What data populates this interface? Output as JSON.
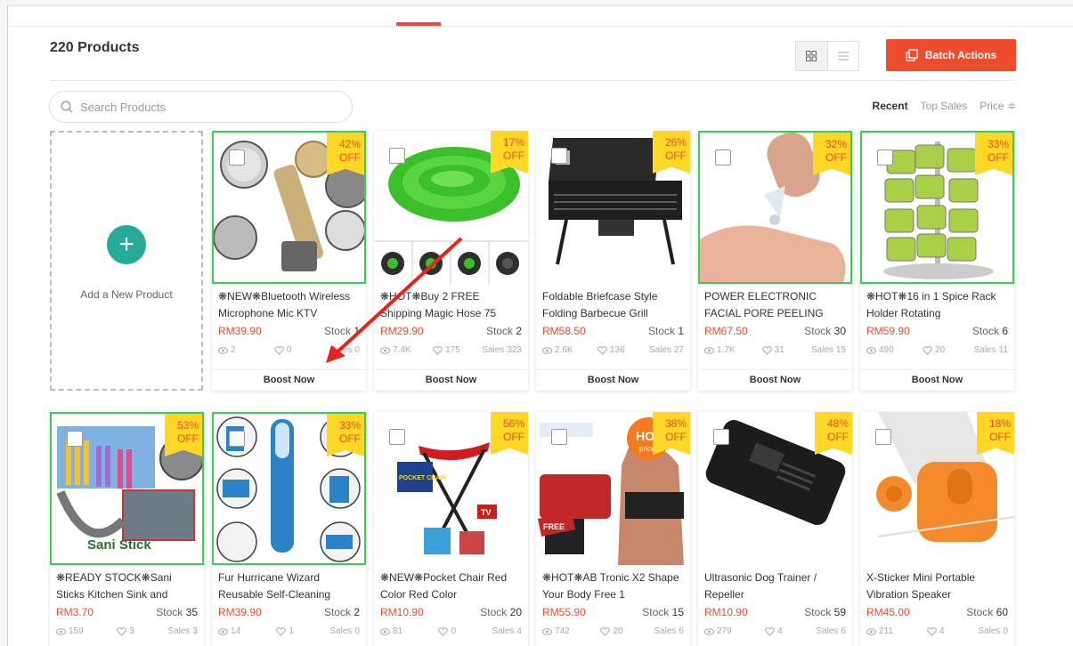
{
  "header": {
    "title": "220 Products",
    "batch_label": "Batch Actions"
  },
  "search": {
    "placeholder": "Search Products"
  },
  "sort": {
    "recent": "Recent",
    "top_sales": "Top Sales",
    "price": "Price ≑"
  },
  "add_card": {
    "label": "Add a New Product"
  },
  "boost_label": "Boost Now",
  "products": [
    {
      "discount": "42%",
      "off": "OFF",
      "name": "❋NEW❋Bluetooth Wireless Microphone Mic KTV",
      "price": "RM39.90",
      "stock_label": "Stock",
      "stock": "1",
      "views": "2",
      "likes": "0",
      "sales_label": "Sales",
      "sales": "0"
    },
    {
      "discount": "17%",
      "off": "OFF",
      "name": "❋HOT❋Buy 2 FREE Shipping Magic Hose 75",
      "price": "RM29.90",
      "stock_label": "Stock",
      "stock": "2",
      "views": "7.4K",
      "likes": "175",
      "sales_label": "Sales",
      "sales": "323"
    },
    {
      "discount": "26%",
      "off": "OFF",
      "name": "Foldable Briefcase Style Folding Barbecue Grill",
      "price": "RM58.50",
      "stock_label": "Stock",
      "stock": "1",
      "views": "2.6K",
      "likes": "136",
      "sales_label": "Sales",
      "sales": "27"
    },
    {
      "discount": "32%",
      "off": "OFF",
      "name": "POWER ELECTRONIC FACIAL PORE PEELING",
      "price": "RM67.50",
      "stock_label": "Stock",
      "stock": "30",
      "views": "1.7K",
      "likes": "31",
      "sales_label": "Sales",
      "sales": "15"
    },
    {
      "discount": "33%",
      "off": "OFF",
      "name": "❋HOT❋16 in 1 Spice Rack Holder Rotating",
      "price": "RM59.90",
      "stock_label": "Stock",
      "stock": "6",
      "views": "490",
      "likes": "20",
      "sales_label": "Sales",
      "sales": "11"
    },
    {
      "discount": "53%",
      "off": "OFF",
      "name": "❋READY STOCK❋Sani Sticks Kitchen Sink and",
      "price": "RM3.70",
      "stock_label": "Stock",
      "stock": "35",
      "views": "159",
      "likes": "3",
      "sales_label": "Sales",
      "sales": "3"
    },
    {
      "discount": "33%",
      "off": "OFF",
      "name": "Fur Hurricane Wizard Reusable Self-Cleaning",
      "price": "RM39.90",
      "stock_label": "Stock",
      "stock": "2",
      "views": "14",
      "likes": "1",
      "sales_label": "Sales",
      "sales": "0"
    },
    {
      "discount": "56%",
      "off": "OFF",
      "name": "❋NEW❋Pocket Chair Red Color Red Color",
      "price": "RM10.90",
      "stock_label": "Stock",
      "stock": "20",
      "views": "81",
      "likes": "0",
      "sales_label": "Sales",
      "sales": "4"
    },
    {
      "discount": "38%",
      "off": "OFF",
      "name": "❋HOT❋AB Tronic X2 Shape Your Body Free 1",
      "price": "RM55.90",
      "stock_label": "Stock",
      "stock": "15",
      "views": "742",
      "likes": "20",
      "sales_label": "Sales",
      "sales": "6"
    },
    {
      "discount": "48%",
      "off": "OFF",
      "name": "Ultrasonic Dog Trainer / Repeller",
      "price": "RM10.90",
      "stock_label": "Stock",
      "stock": "59",
      "views": "279",
      "likes": "4",
      "sales_label": "Sales",
      "sales": "6"
    },
    {
      "discount": "18%",
      "off": "OFF",
      "name": "X-Sticker Mini Portable Vibration Speaker",
      "price": "RM45.00",
      "stock_label": "Stock",
      "stock": "60",
      "views": "211",
      "likes": "4",
      "sales_label": "Sales",
      "sales": "0"
    }
  ],
  "image_text": {
    "sani_stick": "Sani Stick",
    "hot": "HOT",
    "price_word": "price",
    "free": "FREE",
    "tv": "TV",
    "pocket_chair": "POCKET CHAIR"
  },
  "colors": {
    "accent": "#ee4d2d",
    "teal": "#26aa99",
    "badge": "#ffd724",
    "selected_border": "#34d058"
  }
}
